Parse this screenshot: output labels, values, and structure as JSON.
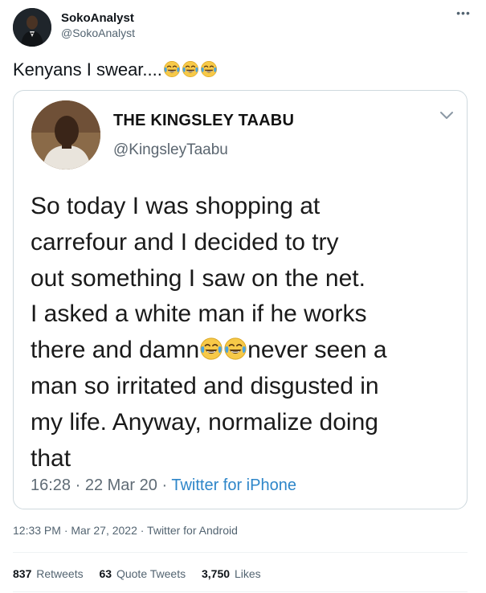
{
  "author": {
    "display_name": "SokoAnalyst",
    "handle": "@SokoAnalyst"
  },
  "more_label": "•••",
  "tweet": {
    "text": "Kenyans I swear....",
    "emoji_count": 3,
    "emoji": "face-with-tears-of-joy"
  },
  "quoted": {
    "display_name": "THE KINGSLEY TAABU",
    "handle": "@KingsleyTaabu",
    "body_before": "So today I was shopping at\ncarrefour and I decided to try\nout something I saw on the net.\nI asked a white man if he works\nthere and damn",
    "body_after": "never seen a\nman so irritated and disgusted in\nmy life. Anyway, normalize doing\nthat",
    "emoji_count": 2,
    "time": "16:28",
    "date": "22 Mar 20",
    "separator": " · ",
    "app": "Twitter for iPhone"
  },
  "meta": {
    "timestamp": "12:33 PM · Mar 27, 2022 · Twitter for Android"
  },
  "stats": {
    "retweets_count": "837",
    "retweets_label": "Retweets",
    "quotes_count": "63",
    "quotes_label": "Quote Tweets",
    "likes_count": "3,750",
    "likes_label": "Likes"
  },
  "colors": {
    "emoji_face": "#f7c948",
    "tears": "#4aa3e0",
    "link": "#2e86c9"
  }
}
